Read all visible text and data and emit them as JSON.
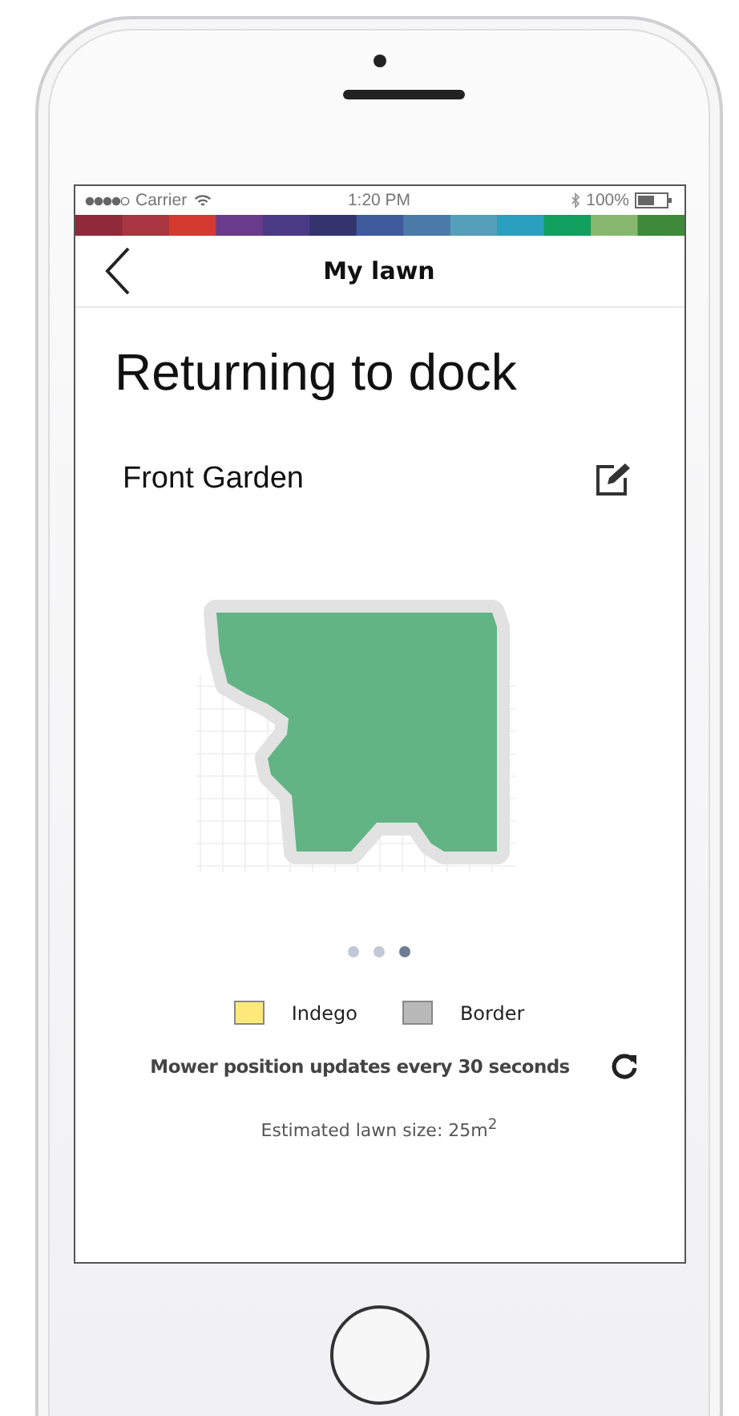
{
  "status_bar": {
    "carrier": "Carrier",
    "time": "1:20 PM",
    "battery": "100%"
  },
  "header": {
    "title": "My lawn"
  },
  "status_title": "Returning to dock",
  "lawn": {
    "name": "Front Garden"
  },
  "pager": [
    {
      "selected": false
    },
    {
      "selected": false
    },
    {
      "selected": true
    }
  ],
  "legend": [
    {
      "label": "Indego",
      "color": "#fde97a"
    },
    {
      "label": "Border",
      "color": "#b9b9b9"
    }
  ],
  "update_note": "Mower position updates every 30 seconds",
  "lawn_size": "Estimated lawn size: 25m$^{2}$"
}
